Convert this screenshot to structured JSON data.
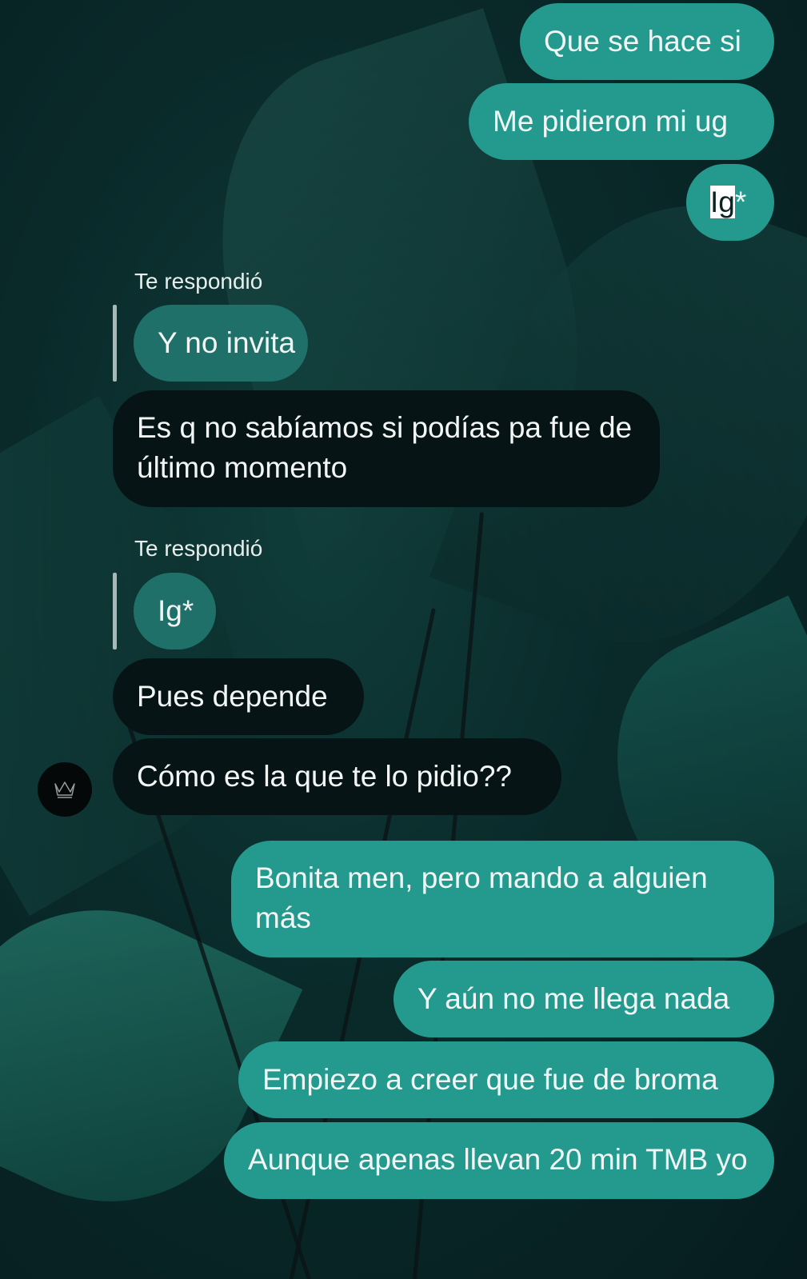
{
  "messages": {
    "m1": {
      "text": "Que se hace si"
    },
    "m2": {
      "text": "Me pidieron mi ug"
    },
    "m3": {
      "text_marked": "Ig",
      "text_rest": "*"
    },
    "m4": {
      "reply_label": "Te respondió",
      "quoted": "Y no invita"
    },
    "m5": {
      "text": "Es q no sabíamos si podías pa fue de último momento"
    },
    "m6": {
      "reply_label": "Te respondió",
      "quoted": "Ig*"
    },
    "m7": {
      "text": "Pues depende"
    },
    "m8": {
      "text": "Cómo es la que te lo pidio??"
    },
    "m9": {
      "text": "Bonita men, pero mando a alguien más"
    },
    "m10": {
      "text": "Y aún no me llega nada"
    },
    "m11": {
      "text": "Empiezo a creer que fue de broma"
    },
    "m12": {
      "text": "Aunque apenas llevan 20 min TMB yo"
    }
  },
  "colors": {
    "outgoing_bubble": "#249a8f",
    "incoming_bubble": "#061416",
    "quoted_bubble": "#1f7069",
    "background": "#0a2a2a"
  },
  "avatar": {
    "icon": "crown-icon"
  }
}
